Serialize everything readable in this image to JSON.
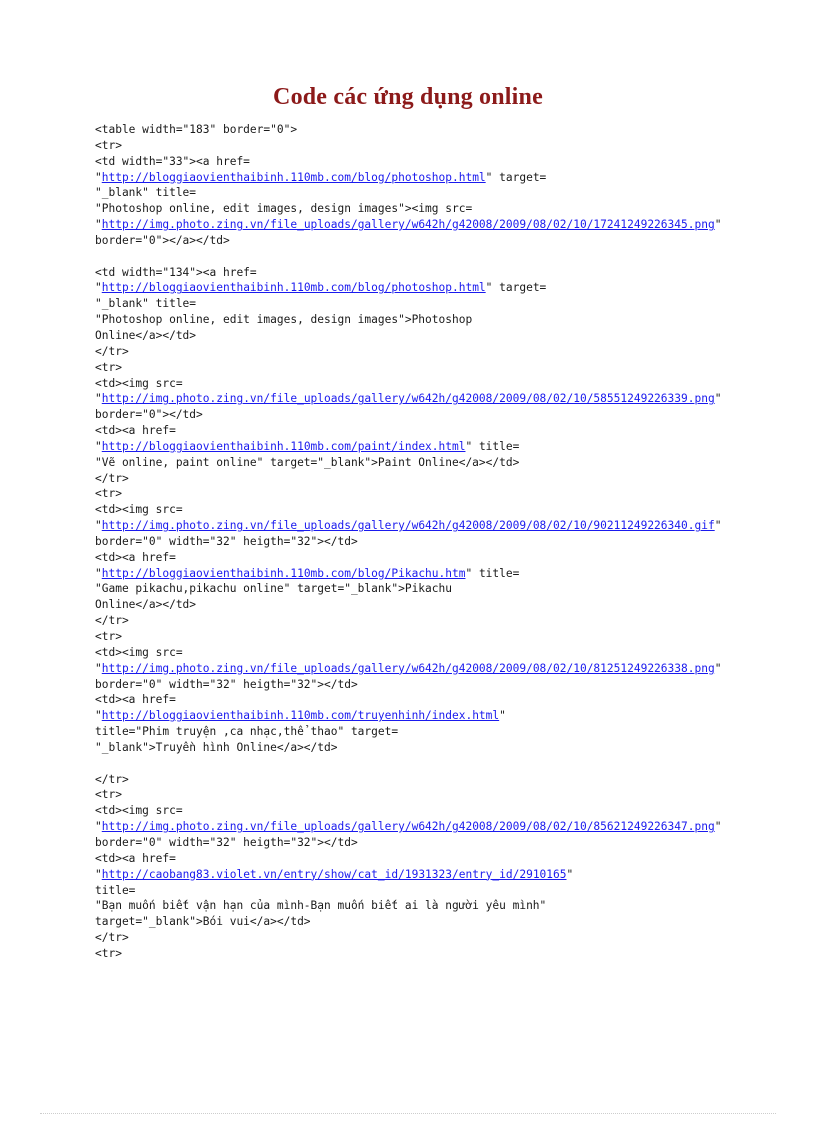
{
  "document": {
    "title": "Code các ứng dụng online"
  },
  "code": {
    "language": "html",
    "lines": [
      {
        "id": "l1",
        "segments": [
          {
            "kind": "text",
            "text": "<table width=\"183\" border=\"0\">"
          }
        ]
      },
      {
        "id": "l2",
        "segments": [
          {
            "kind": "text",
            "text": "<tr>"
          }
        ]
      },
      {
        "id": "l3",
        "segments": [
          {
            "kind": "text",
            "text": "<td width=\"33\"><a href="
          }
        ]
      },
      {
        "id": "l4",
        "segments": [
          {
            "kind": "text",
            "text": "\""
          },
          {
            "kind": "link",
            "text": "http://bloggiaovienthaibinh.110mb.com/blog/photoshop.html"
          },
          {
            "kind": "text",
            "text": "\" target="
          }
        ]
      },
      {
        "id": "l5",
        "segments": [
          {
            "kind": "text",
            "text": "\"_blank\" title="
          }
        ]
      },
      {
        "id": "l6",
        "segments": [
          {
            "kind": "text",
            "text": "\"Photoshop online, edit images, design images\"><img src="
          }
        ]
      },
      {
        "id": "l7",
        "segments": [
          {
            "kind": "text",
            "text": "\""
          },
          {
            "kind": "link",
            "text": "http://img.photo.zing.vn/file_uploads/gallery/w642h/g42008/2009/08/02/10/17241249226345.png"
          },
          {
            "kind": "text",
            "text": "\""
          }
        ]
      },
      {
        "id": "l8",
        "segments": [
          {
            "kind": "text",
            "text": "border=\"0\"></a></td>"
          }
        ]
      },
      {
        "id": "l9",
        "blank": true,
        "segments": []
      },
      {
        "id": "l10",
        "segments": [
          {
            "kind": "text",
            "text": "<td width=\"134\"><a href="
          }
        ]
      },
      {
        "id": "l11",
        "segments": [
          {
            "kind": "text",
            "text": "\""
          },
          {
            "kind": "link",
            "text": "http://bloggiaovienthaibinh.110mb.com/blog/photoshop.html"
          },
          {
            "kind": "text",
            "text": "\" target="
          }
        ]
      },
      {
        "id": "l12",
        "segments": [
          {
            "kind": "text",
            "text": "\"_blank\" title="
          }
        ]
      },
      {
        "id": "l13",
        "segments": [
          {
            "kind": "text",
            "text": "\"Photoshop online, edit images, design images\">Photoshop"
          }
        ]
      },
      {
        "id": "l14",
        "segments": [
          {
            "kind": "text",
            "text": "Online</a></td>"
          }
        ]
      },
      {
        "id": "l15",
        "segments": [
          {
            "kind": "text",
            "text": "</tr>"
          }
        ]
      },
      {
        "id": "l16",
        "segments": [
          {
            "kind": "text",
            "text": "<tr>"
          }
        ]
      },
      {
        "id": "l17",
        "segments": [
          {
            "kind": "text",
            "text": "<td><img src="
          }
        ]
      },
      {
        "id": "l18",
        "segments": [
          {
            "kind": "text",
            "text": "\""
          },
          {
            "kind": "link",
            "text": "http://img.photo.zing.vn/file_uploads/gallery/w642h/g42008/2009/08/02/10/58551249226339.png"
          },
          {
            "kind": "text",
            "text": "\""
          }
        ]
      },
      {
        "id": "l19",
        "segments": [
          {
            "kind": "text",
            "text": "border=\"0\"></td>"
          }
        ]
      },
      {
        "id": "l20",
        "segments": [
          {
            "kind": "text",
            "text": "<td><a href="
          }
        ]
      },
      {
        "id": "l21",
        "segments": [
          {
            "kind": "text",
            "text": "\""
          },
          {
            "kind": "link",
            "text": "http://bloggiaovienthaibinh.110mb.com/paint/index.html"
          },
          {
            "kind": "text",
            "text": "\" title="
          }
        ]
      },
      {
        "id": "l22",
        "segments": [
          {
            "kind": "text",
            "text": "\"Vẽ online, paint online\" target=\"_blank\">Paint Online</a></td>"
          }
        ]
      },
      {
        "id": "l23",
        "segments": [
          {
            "kind": "text",
            "text": "</tr>"
          }
        ]
      },
      {
        "id": "l24",
        "segments": [
          {
            "kind": "text",
            "text": "<tr>"
          }
        ]
      },
      {
        "id": "l25",
        "segments": [
          {
            "kind": "text",
            "text": "<td><img src="
          }
        ]
      },
      {
        "id": "l26",
        "segments": [
          {
            "kind": "text",
            "text": "\""
          },
          {
            "kind": "link",
            "text": "http://img.photo.zing.vn/file_uploads/gallery/w642h/g42008/2009/08/02/10/90211249226340.gif"
          },
          {
            "kind": "text",
            "text": "\""
          }
        ]
      },
      {
        "id": "l27",
        "segments": [
          {
            "kind": "text",
            "text": "border=\"0\" width=\"32\" heigth=\"32\"></td>"
          }
        ]
      },
      {
        "id": "l28",
        "segments": [
          {
            "kind": "text",
            "text": "<td><a href="
          }
        ]
      },
      {
        "id": "l29",
        "segments": [
          {
            "kind": "text",
            "text": "\""
          },
          {
            "kind": "link",
            "text": "http://bloggiaovienthaibinh.110mb.com/blog/Pikachu.htm"
          },
          {
            "kind": "text",
            "text": "\" title="
          }
        ]
      },
      {
        "id": "l30",
        "segments": [
          {
            "kind": "text",
            "text": "\"Game pikachu,pikachu online\" target=\"_blank\">Pikachu"
          }
        ]
      },
      {
        "id": "l31",
        "segments": [
          {
            "kind": "text",
            "text": "Online</a></td>"
          }
        ]
      },
      {
        "id": "l32",
        "segments": [
          {
            "kind": "text",
            "text": "</tr>"
          }
        ]
      },
      {
        "id": "l33",
        "segments": [
          {
            "kind": "text",
            "text": "<tr>"
          }
        ]
      },
      {
        "id": "l34",
        "segments": [
          {
            "kind": "text",
            "text": "<td><img src="
          }
        ]
      },
      {
        "id": "l35",
        "segments": [
          {
            "kind": "text",
            "text": "\""
          },
          {
            "kind": "link",
            "text": "http://img.photo.zing.vn/file_uploads/gallery/w642h/g42008/2009/08/02/10/81251249226338.png"
          },
          {
            "kind": "text",
            "text": "\""
          }
        ]
      },
      {
        "id": "l36",
        "segments": [
          {
            "kind": "text",
            "text": "border=\"0\" width=\"32\" heigth=\"32\"></td>"
          }
        ]
      },
      {
        "id": "l37",
        "segments": [
          {
            "kind": "text",
            "text": "<td><a href="
          }
        ]
      },
      {
        "id": "l38",
        "segments": [
          {
            "kind": "text",
            "text": "\""
          },
          {
            "kind": "link",
            "text": "http://bloggiaovienthaibinh.110mb.com/truyenhinh/index.html"
          },
          {
            "kind": "text",
            "text": "\""
          }
        ]
      },
      {
        "id": "l39",
        "segments": [
          {
            "kind": "text",
            "text": "title=\"Phim truyện ,ca nhạc,thể thao\" target="
          }
        ]
      },
      {
        "id": "l40",
        "segments": [
          {
            "kind": "text",
            "text": "\"_blank\">Truyền hình Online</a></td>"
          }
        ]
      },
      {
        "id": "l41",
        "blank": true,
        "segments": []
      },
      {
        "id": "l42",
        "segments": [
          {
            "kind": "text",
            "text": "</tr>"
          }
        ]
      },
      {
        "id": "l43",
        "segments": [
          {
            "kind": "text",
            "text": "<tr>"
          }
        ]
      },
      {
        "id": "l44",
        "segments": [
          {
            "kind": "text",
            "text": "<td><img src="
          }
        ]
      },
      {
        "id": "l45",
        "segments": [
          {
            "kind": "text",
            "text": "\""
          },
          {
            "kind": "link",
            "text": "http://img.photo.zing.vn/file_uploads/gallery/w642h/g42008/2009/08/02/10/85621249226347.png"
          },
          {
            "kind": "text",
            "text": "\""
          }
        ]
      },
      {
        "id": "l46",
        "segments": [
          {
            "kind": "text",
            "text": "border=\"0\" width=\"32\" heigth=\"32\"></td>"
          }
        ]
      },
      {
        "id": "l47",
        "segments": [
          {
            "kind": "text",
            "text": "<td><a href="
          }
        ]
      },
      {
        "id": "l48",
        "segments": [
          {
            "kind": "text",
            "text": "\""
          },
          {
            "kind": "link",
            "text": "http://caobang83.violet.vn/entry/show/cat_id/1931323/entry_id/2910165"
          },
          {
            "kind": "text",
            "text": "\""
          }
        ]
      },
      {
        "id": "l49",
        "segments": [
          {
            "kind": "text",
            "text": "title="
          }
        ]
      },
      {
        "id": "l50",
        "segments": [
          {
            "kind": "text",
            "text": "\"Bạn muốn biết vận hạn của mình-Bạn muốn biết ai là người yêu mình\""
          }
        ]
      },
      {
        "id": "l51",
        "segments": [
          {
            "kind": "text",
            "text": "target=\"_blank\">Bói vui</a></td>"
          }
        ]
      },
      {
        "id": "l52",
        "segments": [
          {
            "kind": "text",
            "text": "</tr>"
          }
        ]
      },
      {
        "id": "l53",
        "segments": [
          {
            "kind": "text",
            "text": "<tr>"
          }
        ]
      }
    ]
  },
  "colors": {
    "title": "#8c1a1a",
    "code_text": "#1a1a1a",
    "link": "#1a1aee",
    "page_background": "#ffffff",
    "footer_rule": "#bdbdbd"
  }
}
